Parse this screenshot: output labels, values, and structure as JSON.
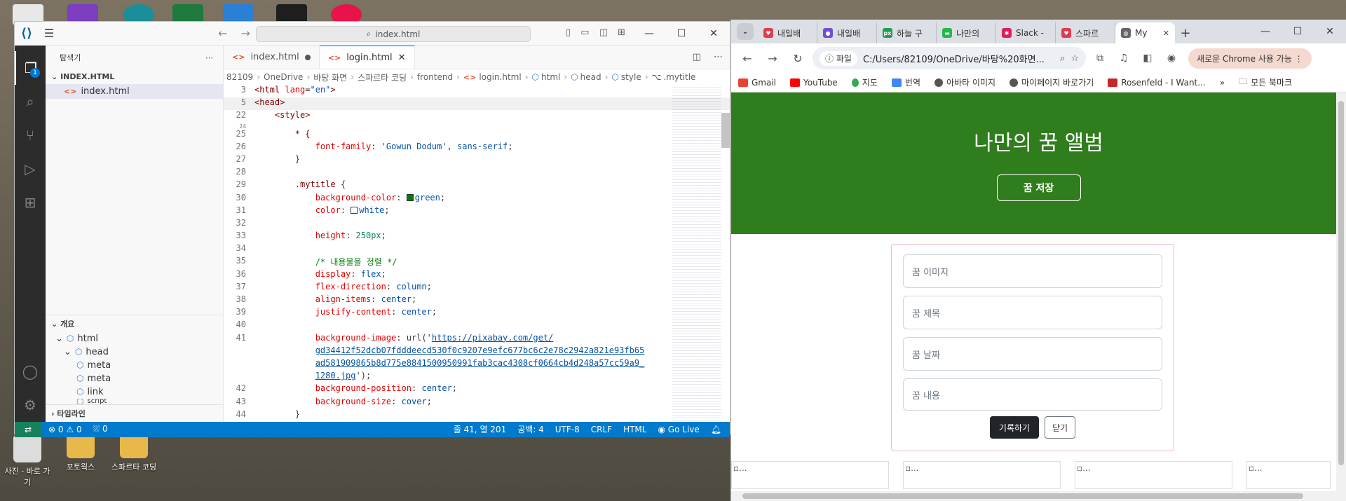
{
  "desktop": {
    "icons": [
      {
        "label": "사진 - 바로 가기"
      },
      {
        "label": "포토웍스"
      },
      {
        "label": "스파르타 코딩"
      }
    ]
  },
  "vscode": {
    "search_placeholder": "index.html",
    "sidebar": {
      "title": "탐색기",
      "section": "INDEX.HTML",
      "file": "index.html",
      "outline_title": "개요",
      "outline_items": [
        "html",
        "head",
        "meta",
        "meta",
        "link",
        "script"
      ],
      "timeline_title": "타임라인"
    },
    "activity_badge": "1",
    "tabs": [
      {
        "label": "index.html"
      },
      {
        "label": "login.html"
      }
    ],
    "breadcrumb": [
      "82109",
      "OneDrive",
      "바탕 화면",
      "스파르타 코딩",
      "frontend",
      "login.html",
      "html",
      "head",
      "style",
      ".mytitle"
    ],
    "code": {
      "line_numbers": [
        "3",
        "5",
        "22",
        "24",
        "25",
        "26",
        "27",
        "28",
        "29",
        "30",
        "31",
        "32",
        "33",
        "34",
        "35",
        "36",
        "37",
        "38",
        "39",
        "40",
        "41",
        "",
        "",
        "",
        "42",
        "43",
        "44"
      ],
      "l3_tag": "<html",
      "l3_attr": "lang",
      "l3_val": "\"en\"",
      "l3_end": ">",
      "l5": "<head>",
      "l22": "<style>",
      "l25": "* {",
      "l26_prop": "font-family",
      "l26_val": "'Gowun Dodum', sans-serif",
      "l27": "}",
      "l29_sel": ".mytitle",
      "l29_brace": "{",
      "l30_prop": "background-color",
      "l30_val": "green",
      "l31_prop": "color",
      "l31_val": "white",
      "l33_prop": "height",
      "l33_val": "250px",
      "l35": "/* 내용물을 정렬 */",
      "l36_prop": "display",
      "l36_val": "flex",
      "l37_prop": "flex-direction",
      "l37_val": "column",
      "l38_prop": "align-items",
      "l38_val": "center",
      "l39_prop": "justify-content",
      "l39_val": "center",
      "l41_prop": "background-image",
      "l41_fn": "url('",
      "l41_url1": "https://pixabay.com/get/",
      "l41_url2": "gd34412f52dcb07fdddeecd530f0c9207e9efc677bc6c2e78c2942a821e93fb65",
      "l41_url3": "ad581909865b8d775e8841500950991fab3cac4308cf0664cb4d248a57cc59a9_",
      "l41_url4": "1280.jpg",
      "l41_end": "');",
      "l42_prop": "background-position",
      "l42_val": "center",
      "l43_prop": "background-size",
      "l43_val": "cover",
      "l44": "}"
    },
    "status": {
      "errors": "0",
      "warnings": "0",
      "ports": "0",
      "position": "줄 41, 열 201",
      "spaces": "공백: 4",
      "encoding": "UTF-8",
      "eol": "CRLF",
      "language": "HTML",
      "golive": "Go Live"
    }
  },
  "chrome": {
    "tabs": [
      {
        "label": "내일배",
        "color": "#e53950"
      },
      {
        "label": "내일배",
        "color": "#6f4fd8"
      },
      {
        "label": "하늘 구",
        "color": "#1d9d5b"
      },
      {
        "label": "나만의",
        "color": "#25b848"
      },
      {
        "label": "Slack -",
        "color": "#e01e5a"
      },
      {
        "label": "스파르",
        "color": "#e53950"
      },
      {
        "label": "My",
        "color": "#666666"
      }
    ],
    "address": {
      "chip": "파일",
      "url": "C:/Users/82109/OneDrive/바탕%20화면..."
    },
    "promo": "새로운 Chrome 사용 가능",
    "bookmarks": [
      "Gmail",
      "YouTube",
      "지도",
      "번역",
      "아바타 이미지",
      "마이페이지 바로가기",
      "Rosenfeld - I Want..."
    ],
    "bookmarks_all": "모든 북마크",
    "page": {
      "title": "나만의 꿈 앨범",
      "save_button": "꿈 저장",
      "fields": [
        "꿈 이미지",
        "꿈 제목",
        "꿈 날짜",
        "꿈 내용"
      ],
      "submit": "기록하기",
      "close": "닫기",
      "card_alt": "..."
    }
  }
}
